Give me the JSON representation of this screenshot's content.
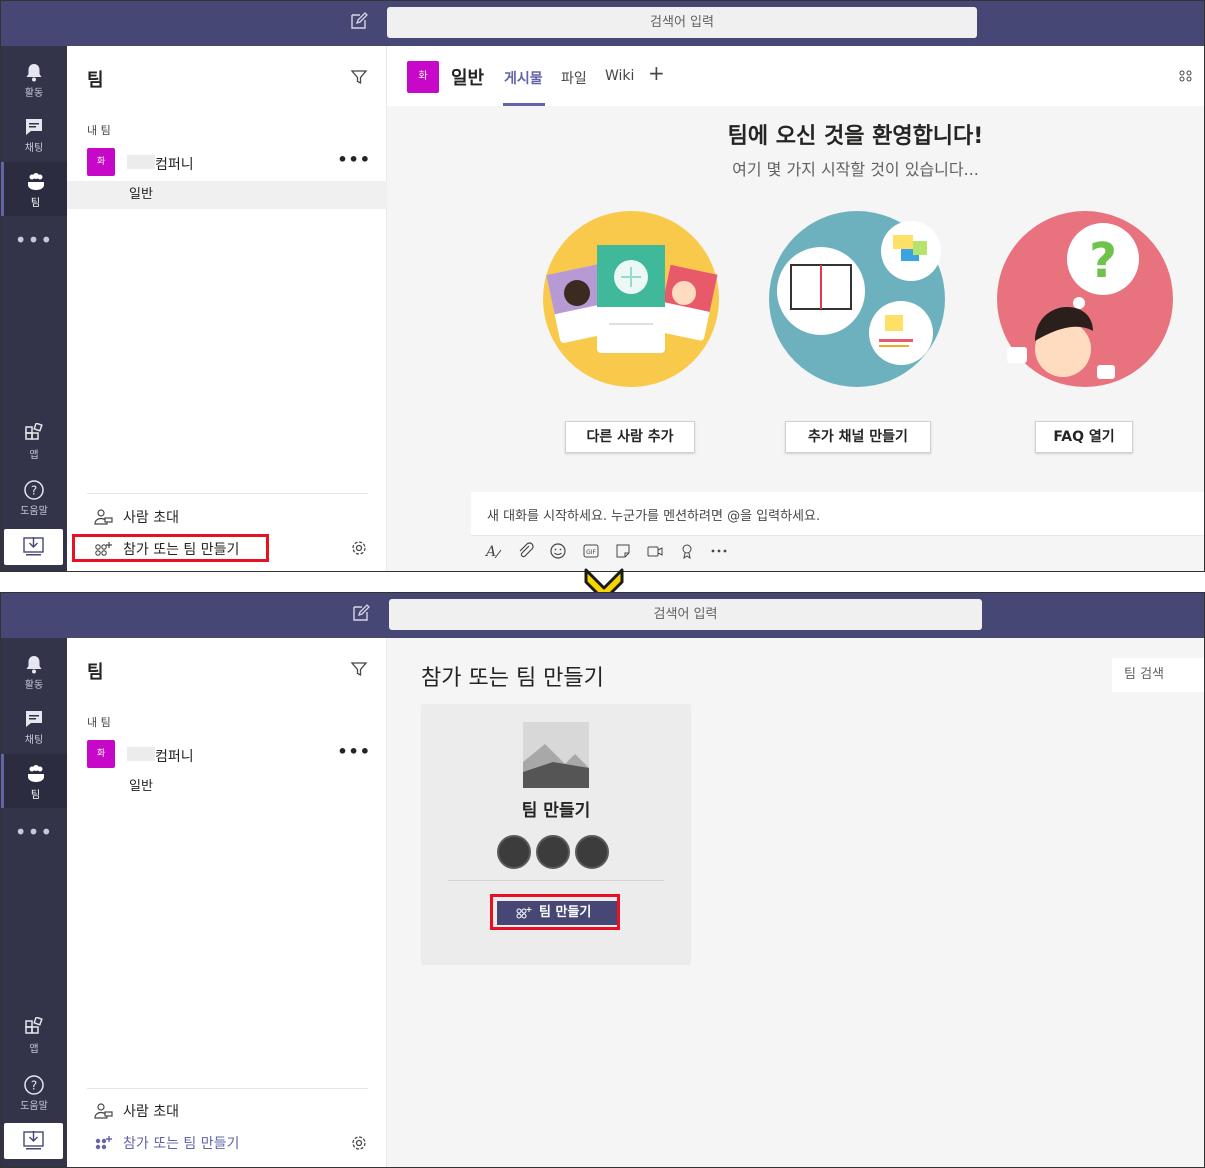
{
  "search_placeholder": "검색어 입력",
  "rail": {
    "activity": "활동",
    "chat": "채팅",
    "teams": "팀",
    "more": "•••",
    "apps": "앱",
    "help": "도움말"
  },
  "teams_panel": {
    "title": "팀",
    "section_label": "내 팀",
    "team_avatar_text": "화",
    "team_name": "컴퍼니",
    "team_more": "•••",
    "channel_name": "일반",
    "invite_label": "사람 초대",
    "join_create_label": "참가 또는 팀 만들기"
  },
  "channel": {
    "avatar_text": "화",
    "name": "일반",
    "tabs": [
      {
        "label": "게시물",
        "active": true
      },
      {
        "label": "파일",
        "active": false
      },
      {
        "label": "Wiki",
        "active": false
      }
    ],
    "add_tab": "+"
  },
  "welcome": {
    "title": "팀에 오신 것을 환영합니다!",
    "subtitle": "여기 몇 가지 시작할 것이 있습니다...",
    "actions": [
      {
        "label": "다른 사람 추가",
        "illustration": "add-people",
        "color": "#f9c94c"
      },
      {
        "label": "추가 채널 만들기",
        "illustration": "notebook-channels",
        "color": "#6db1bf"
      },
      {
        "label": "FAQ 열기",
        "illustration": "question-person",
        "color": "#e9727f"
      }
    ]
  },
  "composer": {
    "placeholder": "새 대화를 시작하세요. 누군가를 멘션하려면 @을 입력하세요.",
    "tools": [
      "format-icon",
      "attach-icon",
      "emoji-icon",
      "gif-icon",
      "sticker-icon",
      "meet-icon",
      "praise-icon",
      "more-icon"
    ]
  },
  "join_create": {
    "title": "참가 또는 팀 만들기",
    "search_label": "팀 검색",
    "card_title": "팀 만들기",
    "card_button": "팀 만들기"
  },
  "colors": {
    "topbar": "#464775",
    "rail": "#33344a",
    "accent": "#6264a7",
    "highlight": "#e81123",
    "team_avatar": "#c808c8",
    "transition_arrow": "#f5d400"
  }
}
